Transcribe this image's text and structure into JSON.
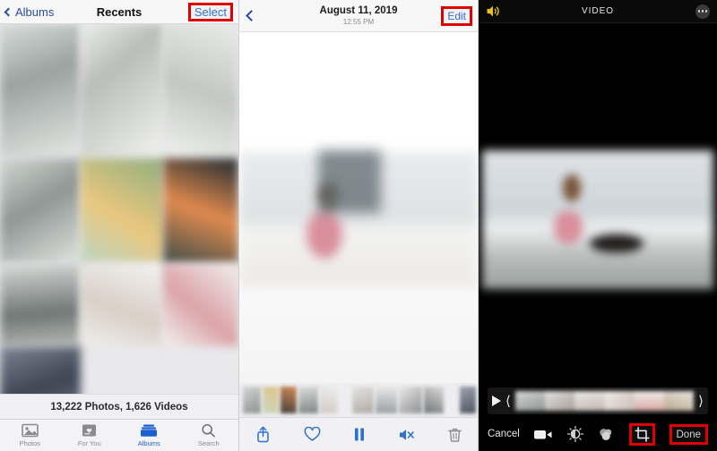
{
  "panels": {
    "photos_library": {
      "nav": {
        "back_label": "Albums",
        "back_icon": "chevron-left-icon",
        "title": "Recents",
        "action_label": "Select",
        "action_highlighted": true,
        "highlight_color": "#e00000",
        "link_color": "#2f6fd0"
      },
      "status_text": "13,222 Photos, 1,626 Videos",
      "tabs": [
        {
          "label": "Photos",
          "icon": "photos-icon",
          "active": false
        },
        {
          "label": "For You",
          "icon": "for-you-icon",
          "active": false
        },
        {
          "label": "Albums",
          "icon": "albums-icon",
          "active": true
        },
        {
          "label": "Search",
          "icon": "search-icon",
          "active": false
        }
      ],
      "grid_note": "blurred photo thumbnails"
    },
    "video_viewer": {
      "nav": {
        "back_icon": "chevron-left-icon",
        "date": "August 11, 2019",
        "time": "12:55 PM",
        "action_label": "Edit",
        "action_highlighted": true,
        "highlight_color": "#e00000",
        "link_color": "#2f6fd0"
      },
      "toolbar": [
        {
          "name": "share-icon",
          "label": "Share"
        },
        {
          "name": "heart-icon",
          "label": "Favorite"
        },
        {
          "name": "pause-icon",
          "label": "Pause"
        },
        {
          "name": "mute-icon",
          "label": "Mute"
        },
        {
          "name": "trash-icon",
          "label": "Delete"
        }
      ],
      "filmstrip_note": "blurred frame thumbnails"
    },
    "video_editor": {
      "nav": {
        "speaker_icon": "speaker-on-icon",
        "speaker_color": "#e8c020",
        "title": "VIDEO",
        "more_icon": "more-ellipsis-icon"
      },
      "trim": {
        "play_icon": "play-icon",
        "left_handle": "trim-handle-left",
        "right_handle": "trim-handle-right"
      },
      "toolbar": {
        "cancel_label": "Cancel",
        "done_label": "Done",
        "done_highlighted": true,
        "crop_highlighted": true,
        "highlight_color": "#e00000",
        "tools": [
          {
            "name": "video-camera-icon",
            "label": "Trim"
          },
          {
            "name": "adjust-dial-icon",
            "label": "Adjust"
          },
          {
            "name": "filters-icon",
            "label": "Filters"
          },
          {
            "name": "crop-icon",
            "label": "Crop"
          }
        ]
      }
    }
  }
}
